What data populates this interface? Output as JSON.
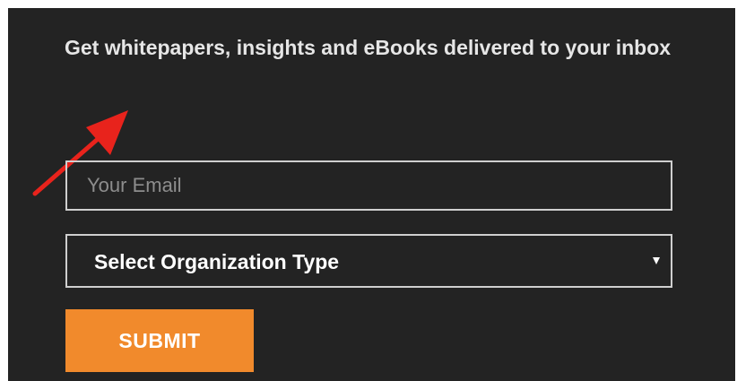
{
  "newsletter": {
    "headline": "Get whitepapers, insights and eBooks delivered to your inbox",
    "email_placeholder": "Your Email",
    "email_value": "",
    "org_select_value": "Select Organization Type",
    "submit_label": "SUBMIT"
  },
  "annotation": {
    "arrow_icon": "red-arrow-icon",
    "arrow_color": "#e8231c"
  },
  "colors": {
    "panel_background": "#232323",
    "accent": "#f18a2c",
    "text": "#e6e6e6",
    "field_border": "#cfcfcf"
  }
}
